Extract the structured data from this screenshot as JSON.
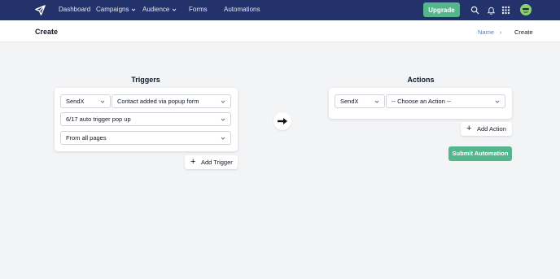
{
  "nav": {
    "items": [
      "Dashboard",
      "Campaigns",
      "Audience",
      "Forms",
      "Automations"
    ],
    "upgrade_label": "Upgrade",
    "colors": {
      "bg": "#23326b",
      "accent": "#55b58d"
    },
    "icons": [
      "logo-paper-plane-icon",
      "search-icon",
      "bell-icon",
      "apps-grid-icon",
      "avatar"
    ]
  },
  "header": {
    "title": "Create",
    "breadcrumb": {
      "name": "Name",
      "separator": "›",
      "current": "Create"
    }
  },
  "triggers": {
    "title": "Triggers",
    "provider": "SendX",
    "event": "Contact added via popup form",
    "popup": "6/17 auto trigger pop up",
    "pages": "From all pages",
    "add_label": "Add Trigger"
  },
  "actions": {
    "title": "Actions",
    "provider": "SendX",
    "action_placeholder": "-- Choose an Action --",
    "add_label": "Add Action",
    "submit_label": "Submit Automation"
  }
}
